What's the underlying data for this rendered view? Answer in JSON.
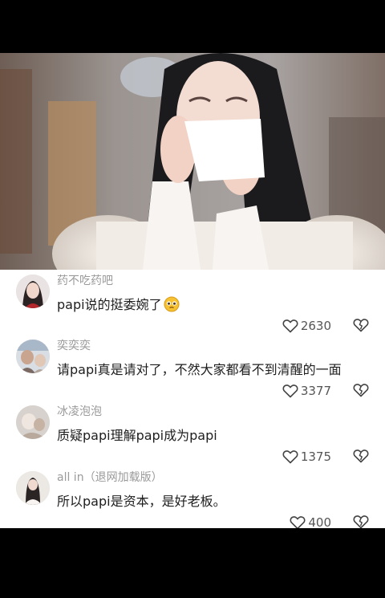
{
  "video": {
    "description": ""
  },
  "comments": [
    {
      "username": "药不吃药吧",
      "text": "papi说的挺委婉了",
      "emoji": "pleading-face",
      "likes": "2630"
    },
    {
      "username": "奕奕奕",
      "text": "请papi真是请对了，不然大家都看不到清醒的一面",
      "likes": "3377"
    },
    {
      "username": "冰凌泡泡",
      "text": "质疑papi理解papi成为papi",
      "likes": "1375"
    },
    {
      "username": "all in（退网加载版）",
      "text": "所以papi是资本，是好老板。",
      "likes": "400"
    }
  ],
  "colors": {
    "background": "#000000",
    "comment_panel": "#ffffff",
    "username": "#9a9a9a",
    "text": "#1e1e1e"
  }
}
